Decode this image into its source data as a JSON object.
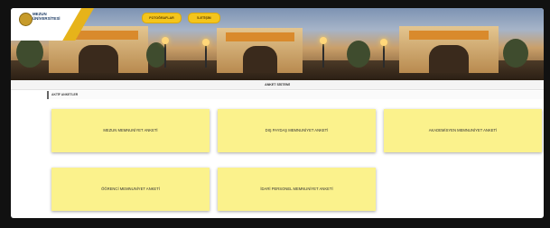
{
  "header": {
    "university_name_line1": "MEZUN",
    "university_name_line2": "ÜNİVERSİTESİ",
    "nav": [
      {
        "label": "FOTOĞRAFLAR"
      },
      {
        "label": "İLETİŞİM"
      }
    ]
  },
  "page_title": "ANKET SİSTEMİ",
  "section_title": "AKTİF ANKETLER",
  "surveys": [
    {
      "label": "MEZUN MEMNUNİYET ANKETİ"
    },
    {
      "label": "DIŞ PAYDAŞ MEMNUNİYET ANKETİ"
    },
    {
      "label": "AKADEMİSYEN MEMNUNİYET ANKETİ"
    },
    {
      "label": "ÖĞRENCİ MEMNUNİYET ANKETİ"
    },
    {
      "label": "İDARİ PERSONEL MEMNUNİYET ANKETİ"
    }
  ],
  "colors": {
    "accent": "#f4c51c",
    "card_background": "#fbf28c",
    "title_bar": "#f4f4f4"
  }
}
